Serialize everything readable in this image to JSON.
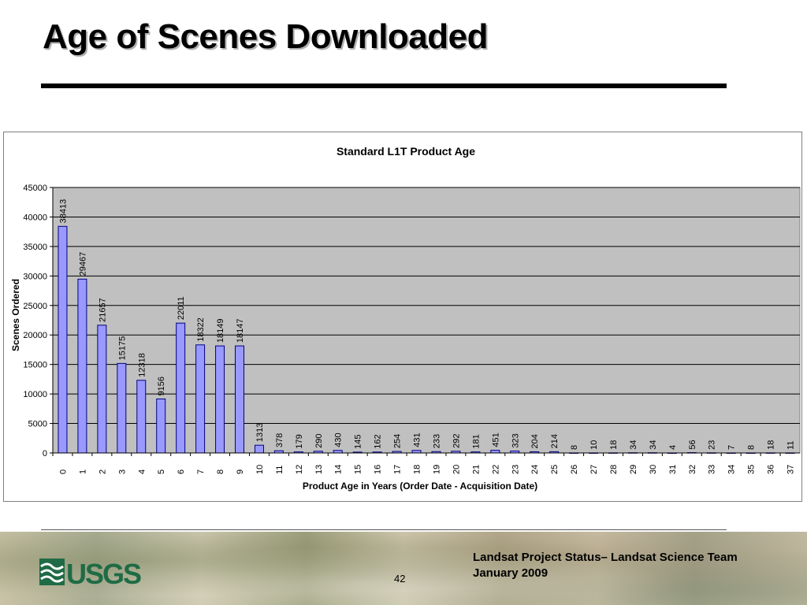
{
  "slide": {
    "title": "Age of Scenes Downloaded",
    "page_number": "42",
    "footer_line1": "Landsat Project Status– Landsat Science Team",
    "footer_line2": "January 2009",
    "logo_text": "USGS"
  },
  "colors": {
    "bar_fill": "#9999ff",
    "bar_stroke": "#000080",
    "plot_bg": "#c0c0c0",
    "gridline": "#000000"
  },
  "chart_data": {
    "type": "bar",
    "title": "Standard L1T Product Age",
    "xlabel": "Product Age in Years (Order Date - Acquisition Date)",
    "ylabel": "Scenes Ordered",
    "ylim": [
      0,
      45000
    ],
    "yticks": [
      0,
      5000,
      10000,
      15000,
      20000,
      25000,
      30000,
      35000,
      40000,
      45000
    ],
    "grid": true,
    "legend": "none",
    "categories": [
      "0",
      "1",
      "2",
      "3",
      "4",
      "5",
      "6",
      "7",
      "8",
      "9",
      "10",
      "11",
      "12",
      "13",
      "14",
      "15",
      "16",
      "17",
      "18",
      "19",
      "20",
      "21",
      "22",
      "23",
      "24",
      "25",
      "26",
      "27",
      "28",
      "29",
      "30",
      "31",
      "32",
      "33",
      "34",
      "35",
      "36",
      "37"
    ],
    "values": [
      38413,
      29467,
      21657,
      15175,
      12318,
      9156,
      22011,
      18322,
      18149,
      18147,
      1313,
      378,
      179,
      290,
      430,
      145,
      162,
      254,
      431,
      233,
      292,
      181,
      451,
      323,
      204,
      214,
      8,
      10,
      18,
      34,
      34,
      4,
      56,
      23,
      7,
      8,
      18,
      11
    ]
  }
}
